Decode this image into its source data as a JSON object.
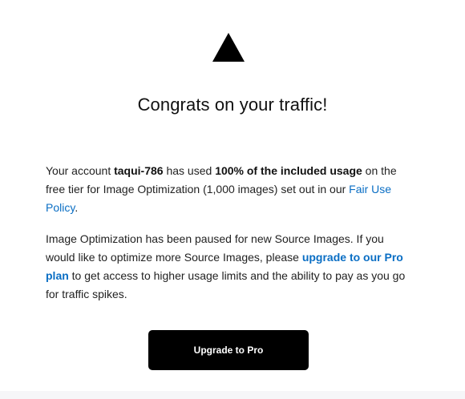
{
  "logo": {
    "icon": "triangle-icon",
    "color": "#000000"
  },
  "title": "Congrats on your traffic!",
  "paragraph1": {
    "text1": "Your account ",
    "account": "taqui-786",
    "text2": " has used ",
    "usage": "100% of the included usage",
    "text3": " on the free tier for Image Optimization (1,000 images) set out in our ",
    "policy_link": "Fair Use Policy",
    "text4": "."
  },
  "paragraph2": {
    "text1": "Image Optimization has been paused for new Source Images. If you would like to optimize more Source Images, please ",
    "upgrade_link": "upgrade to our Pro plan",
    "text2": " to get access to higher usage limits and the ability to pay as you go for traffic spikes."
  },
  "cta": {
    "label": "Upgrade to Pro"
  },
  "colors": {
    "link": "#0a6ec4",
    "button_bg": "#000000",
    "button_text": "#ffffff"
  }
}
